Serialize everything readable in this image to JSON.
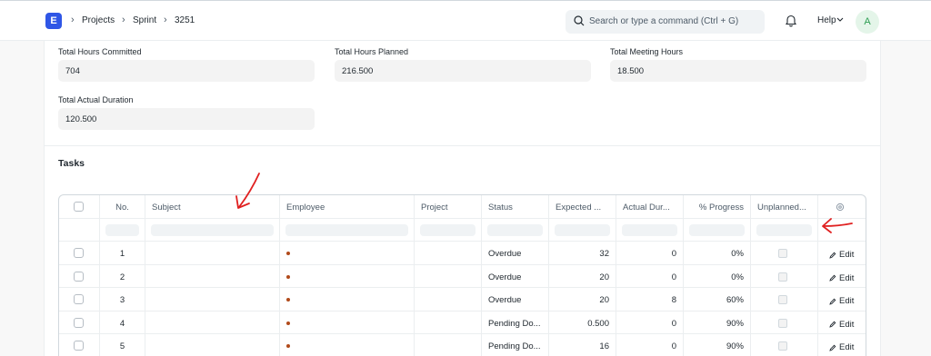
{
  "navbar": {
    "logo_letter": "E",
    "breadcrumbs": [
      "Projects",
      "Sprint",
      "3251"
    ],
    "search_placeholder": "Search or type a command (Ctrl + G)",
    "help_label": "Help",
    "avatar_letter": "A"
  },
  "summary": {
    "total_hours_committed_label": "Total Hours Committed",
    "total_hours_committed": "704",
    "total_hours_planned_label": "Total Hours Planned",
    "total_hours_planned": "216.500",
    "total_meeting_hours_label": "Total Meeting Hours",
    "total_meeting_hours": "18.500",
    "total_actual_duration_label": "Total Actual Duration",
    "total_actual_duration": "120.500"
  },
  "tasks": {
    "title": "Tasks",
    "columns": [
      "No.",
      "Subject",
      "Employee",
      "Project",
      "Status",
      "Expected ...",
      "Actual Dur...",
      "% Progress",
      "Unplanned..."
    ],
    "edit_label": "Edit",
    "rows": [
      {
        "no": "1",
        "status": "Overdue",
        "expected": "32",
        "actual": "0",
        "progress": "0%"
      },
      {
        "no": "2",
        "status": "Overdue",
        "expected": "20",
        "actual": "0",
        "progress": "0%"
      },
      {
        "no": "3",
        "status": "Overdue",
        "expected": "20",
        "actual": "8",
        "progress": "60%"
      },
      {
        "no": "4",
        "status": "Pending Do...",
        "expected": "0.500",
        "actual": "0",
        "progress": "90%"
      },
      {
        "no": "5",
        "status": "Pending Do...",
        "expected": "16",
        "actual": "0",
        "progress": "90%"
      }
    ]
  },
  "colors": {
    "brand": "#2f56e6",
    "annotation": "#e02020"
  }
}
